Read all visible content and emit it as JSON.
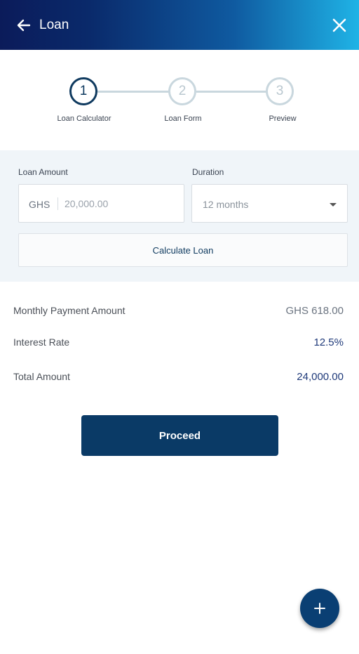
{
  "header": {
    "title": "Loan",
    "back_icon": "arrow-left-icon",
    "close_icon": "close-icon"
  },
  "stepper": {
    "steps": [
      {
        "number": "1",
        "label": "Loan Calculator",
        "state": "active"
      },
      {
        "number": "2",
        "label": "Loan Form",
        "state": "inactive"
      },
      {
        "number": "3",
        "label": "Preview",
        "state": "inactive"
      }
    ]
  },
  "form": {
    "amount_label": "Loan Amount",
    "currency_prefix": "GHS",
    "amount_placeholder": "20,000.00",
    "amount_value": "",
    "duration_label": "Duration",
    "duration_value": "12 months",
    "calculate_label": "Calculate Loan"
  },
  "results": {
    "monthly_label": "Monthly Payment Amount",
    "monthly_value": "GHS 618.00",
    "interest_label": "Interest Rate",
    "interest_value": "12.5%",
    "total_label": "Total Amount",
    "total_value": "24,000.00"
  },
  "actions": {
    "proceed_label": "Proceed",
    "fab_icon": "plus-icon"
  },
  "colors": {
    "primary": "#0a3a66",
    "accent_value": "#1f3a7a",
    "header_gradient_start": "#0b1b5a",
    "header_gradient_end": "#1fb3e6"
  }
}
